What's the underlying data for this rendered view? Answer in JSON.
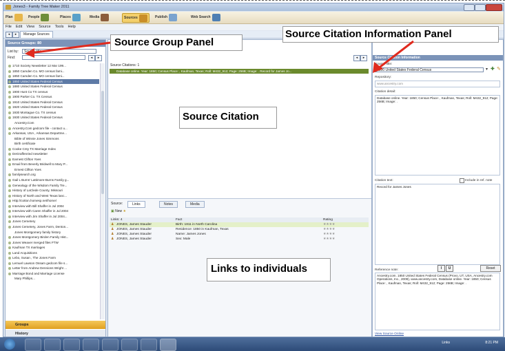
{
  "window": {
    "title": "Jones3 - Family Tree Maker 2011"
  },
  "toolbar": {
    "plan": "Plan",
    "people": "People",
    "places": "Places",
    "media": "Media",
    "sources": "Sources",
    "publish": "Publish",
    "web_search": "Web Search"
  },
  "menu": [
    "File",
    "Edit",
    "View",
    "Source",
    "Tools",
    "Help"
  ],
  "nav": {
    "tab": "Manage Sources"
  },
  "left": {
    "header": "Source Groups: 80",
    "list_by_label": "List by:",
    "list_by_value": "Source title",
    "find_label": "Find:",
    "items": [
      "1710 Society Newsletter 12 Mar 199...",
      "1850 Camden Co. MO census  fami...",
      "1850 Camden Co. MO census  fami...",
      "1850 United States Federal Census",
      "1880 United States Federal Census",
      "1900 Hunt Co TX census",
      "1900 Parker Co. TX Census",
      "1910 United States Federal Census",
      "1920 United States Federal Census",
      "1930 Montague Co. TX census",
      "1930 United States Federal Census",
      "Ancestry.Com",
      "Ancestry.Com gedcom file - contact u...",
      "Arkansas, USA , Arkansas Departme...",
      "Bible of Winnie Jones Simmons",
      "Birth certificate",
      "Cooke Cnty TX Marriage Index",
      "DeGraffenried newsletter",
      "Earnest Clifton Yoes",
      "Email from Beverly Bridwell to Mary P...",
      "Ernest Clifton Yoes",
      "familysearch.org",
      "Gail L Burns' Lattimore-Burns Family g...",
      "Genealogy of the Wisdom Family Tre...",
      "History of LaClede County, Missouri",
      "History of North and West Texas lanc...",
      "Http://cotton.homesp.net/home/",
      "Interview with Bill Shaffer in Jul 2004",
      "Interview with Caren Shaffer in Jul 2004",
      "Interview with Jim Shaffer in Jul 2004...",
      "Jones Cemetery",
      "Jones Cemetery, Jones Farm, Denton...",
      "Jones Montgomery family history",
      "Jones Montgomery Birden Family Hist...",
      "Jones Weaver merged files FTW",
      "Kaufman TX marriages",
      "Land Acquisitions",
      "Lebo, Susan , The Jones Farm",
      "Lemuel Lawson Ossam gedcom file s...",
      "Letter from Andrew Dennions Wright ...",
      "Marriage Bond and Marriage License",
      "Mary Phillips..."
    ],
    "groups_label": "Groups",
    "history_label": "History"
  },
  "center": {
    "citations_count": "Source Citations: 1",
    "citation_row": "Database online. Year: 1850; Census Place: , Kaufman, Texas; Roll: M432_912; Page: 256B; Image: . Record for James Jo...",
    "tabs": {
      "source": "Source:",
      "links": "Links",
      "notes": "Notes",
      "media": "Media"
    },
    "new_label": "New",
    "links_header": {
      "links": "Links: 4",
      "fact": "Fact",
      "rating": "Rating"
    },
    "links": [
      {
        "name": "JONES, James Stauder",
        "fact": "Birth: 1811 in North Carolina",
        "rating": "★★★★"
      },
      {
        "name": "JONES, James Stauder",
        "fact": "Residence: 1850 in Kaufman, Texas",
        "rating": "★★★★"
      },
      {
        "name": "JONES, James Stauder",
        "fact": "Name: James Jones",
        "rating": "★★★★"
      },
      {
        "name": "JONES, James Stauder",
        "fact": "Sex: Male",
        "rating": "★★★★"
      }
    ]
  },
  "right": {
    "header": "Source Citation Information",
    "source_title_label": "Source title:",
    "source_title_value": "1850 United States Federal Census",
    "repository_label": "Repository:",
    "repository_value": "www.ancestry.com",
    "citation_detail_label": "Citation detail:",
    "citation_detail_value": "Database online. Year: 1850; Census Place: , Kaufman, Texas; Roll: M432_912; Page: 256B; Image: .",
    "citation_text_label": "Citation text:",
    "include_label": "Include in ref. note",
    "citation_text_value": "Record for James Jones",
    "reference_note_label": "Reference note:",
    "reset_label": "Reset",
    "reference_note_value": "Ancestry.com. 1850 United States Federal Census (Provo, UT, USA, Ancestry.com Operations, Inc., 2009), www.ancestry.com, Database online. Year: 1850; Census Place: , Kaufman, Texas; Roll: M432_912; Page: 256B; Image: .",
    "view_online": "View Source Online"
  },
  "annotations": {
    "source_group_panel": "Source Group Panel",
    "citation_info_panel": "Source Citation Information Panel",
    "source_citation": "Source Citation",
    "links_to_individuals": "Links to individuals"
  },
  "taskbar": {
    "clock": "8:21 PM",
    "tray_text": "Links"
  },
  "colors": {
    "header_blue": "#7b93b8",
    "selection_green": "#6b8a2d",
    "groups_orange": "#f0b830",
    "annotation_red": "#e02a1e"
  }
}
